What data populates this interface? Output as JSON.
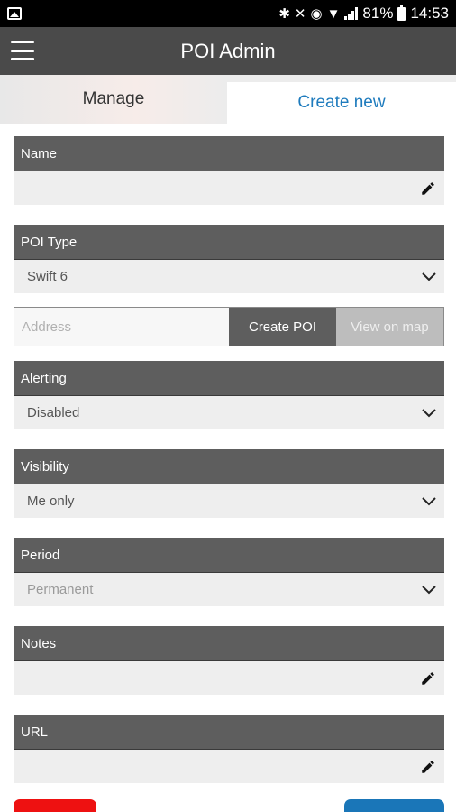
{
  "status_bar": {
    "battery": "81%",
    "time": "14:53",
    "icons": [
      "gallery-icon",
      "bluetooth-icon",
      "mute-icon",
      "alarm-icon",
      "wifi-icon",
      "signal-icon",
      "battery-icon"
    ]
  },
  "app_bar": {
    "title": "POI Admin",
    "menu_icon": "hamburger-menu-icon"
  },
  "tabs": [
    {
      "label": "Manage",
      "active": false
    },
    {
      "label": "Create new",
      "active": true
    }
  ],
  "form": {
    "name": {
      "label": "Name",
      "value": ""
    },
    "poi_type": {
      "label": "POI Type",
      "value": "Swift 6"
    },
    "address": {
      "placeholder": "Address",
      "value": ""
    },
    "create_button": "Create POI",
    "view_button": "View on map",
    "alerting": {
      "label": "Alerting",
      "value": "Disabled"
    },
    "visibility": {
      "label": "Visibility",
      "value": "Me only"
    },
    "period": {
      "label": "Period",
      "value": "Permanent"
    },
    "notes": {
      "label": "Notes",
      "value": ""
    },
    "url": {
      "label": "URL",
      "value": ""
    }
  },
  "colors": {
    "app_bar": "#4a4a4a",
    "header": "#5e5e5e",
    "accent_blue": "#1e7bbd",
    "danger_red": "#ee1111",
    "field_bg": "#eeeeee"
  }
}
